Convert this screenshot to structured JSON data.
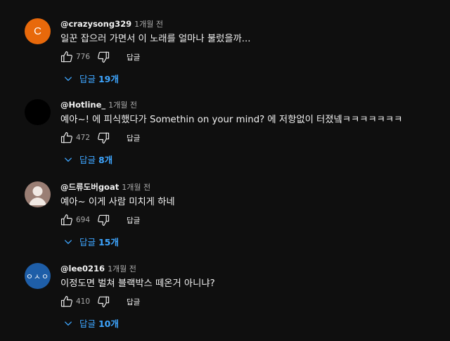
{
  "actions": {
    "reply_label": "답글"
  },
  "comments": [
    {
      "author": "@crazysong329",
      "time": "1개월 전",
      "text": "일꾼 잡으러 가면서 이 노래를 얼마나 불렀을까...",
      "likes": "776",
      "avatar": {
        "kind": "letter",
        "letter": "C",
        "color": "#e8690b"
      },
      "replies": {
        "prefix": "답글 ",
        "count": "19개"
      }
    },
    {
      "author": "@Hotline_",
      "time": "1개월 전",
      "text": "예아~! 에 피식했다가 Somethin on your mind? 에 저항없이 터졌넼ㅋㅋㅋㅋㅋㅋㅋ",
      "likes": "472",
      "avatar": {
        "kind": "solid",
        "color": "#000000"
      },
      "replies": {
        "prefix": "답글 ",
        "count": "8개"
      }
    },
    {
      "author": "@드류도버goat",
      "time": "1개월 전",
      "text": "예아~ 이게 사람 미치게 하네",
      "likes": "694",
      "avatar": {
        "kind": "person",
        "color": "#9a7e74"
      },
      "replies": {
        "prefix": "답글 ",
        "count": "15개"
      }
    },
    {
      "author": "@lee0216",
      "time": "1개월 전",
      "text": "이정도면 벌쳐 블랙박스 떼온거 아니냐?",
      "likes": "410",
      "avatar": {
        "kind": "face",
        "color": "#1e5ea8",
        "letter": "ㅇㅅㅇ"
      },
      "replies": {
        "prefix": "답글 ",
        "count": "10개"
      }
    }
  ]
}
